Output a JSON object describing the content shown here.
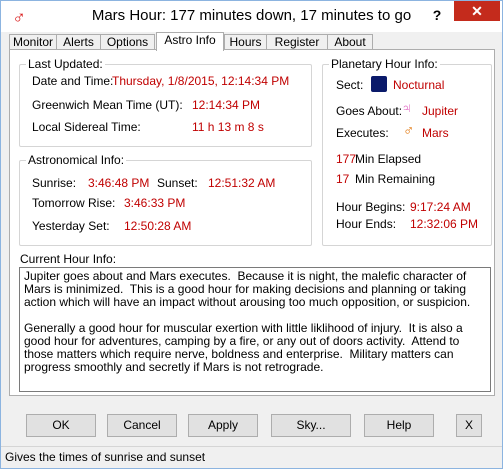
{
  "window": {
    "title": "Mars Hour: 177 minutes down, 17 minutes to go",
    "help_glyph": "?",
    "close_glyph": "✕"
  },
  "tabs": [
    "Monitor",
    "Alerts",
    "Options",
    "Astro Info",
    "Hours",
    "Register",
    "About"
  ],
  "active_tab": "Astro Info",
  "last_updated": {
    "heading": "Last Updated:",
    "date_time_label": "Date and Time:",
    "date_time_value": "Thursday, 1/8/2015, 12:14:34 PM",
    "gmt_label": "Greenwich Mean Time (UT):",
    "gmt_value": "12:14:34 PM",
    "lst_label": "Local Sidereal Time:",
    "lst_value": "11 h 13 m 8 s"
  },
  "astronomical": {
    "heading": "Astronomical Info:",
    "sunrise_label": "Sunrise:",
    "sunrise_value": "3:46:48 PM",
    "sunset_label": "Sunset:",
    "sunset_value": "12:51:32 AM",
    "tomorrow_label": "Tomorrow Rise:",
    "tomorrow_value": "3:46:33 PM",
    "yesterday_label": "Yesterday Set:",
    "yesterday_value": "12:50:28 AM"
  },
  "planetary": {
    "heading": "Planetary Hour Info:",
    "sect_label": "Sect:",
    "sect_value": "Nocturnal",
    "goes_about_label": "Goes About:",
    "goes_about_symbol": "♃",
    "goes_about_value": "Jupiter",
    "executes_label": "Executes:",
    "executes_symbol": "♂",
    "executes_value": "Mars",
    "elapsed_number": "177",
    "elapsed_label": "Min Elapsed",
    "remaining_number": "17",
    "remaining_label": "Min Remaining",
    "begins_label": "Hour Begins:",
    "begins_value": "9:17:24 AM",
    "ends_label": "Hour Ends:",
    "ends_value": "12:32:06 PM"
  },
  "current_hour": {
    "heading": "Current Hour Info:",
    "text": "Jupiter goes about and Mars executes.  Because it is night, the malefic character of Mars is minimized.  This is a good hour for making decisions and planning or taking action which will have an impact without arousing too much opposition, or suspicion.\n\nGenerally a good hour for muscular exertion with little liklihood of injury.  It is also a good hour for adventures, camping by a fire, or any out of doors activity.  Attend to those matters which require nerve, boldness and enterprise.  Military matters can progress smoothly and secretly if Mars is not retrograde."
  },
  "buttons": {
    "ok": "OK",
    "cancel": "Cancel",
    "apply": "Apply",
    "sky": "Sky...",
    "help": "Help",
    "close": "X"
  },
  "status": "Gives the times of sunrise and sunset",
  "colors": {
    "value_red": "#c00000",
    "jupiter_pink": "#e060c0",
    "mars_orange": "#e07000"
  },
  "icons": {
    "app": "mars-symbol-icon",
    "sect": "nocturnal-moon-icon",
    "goes_about": "jupiter-symbol-icon",
    "executes": "mars-symbol-icon"
  }
}
